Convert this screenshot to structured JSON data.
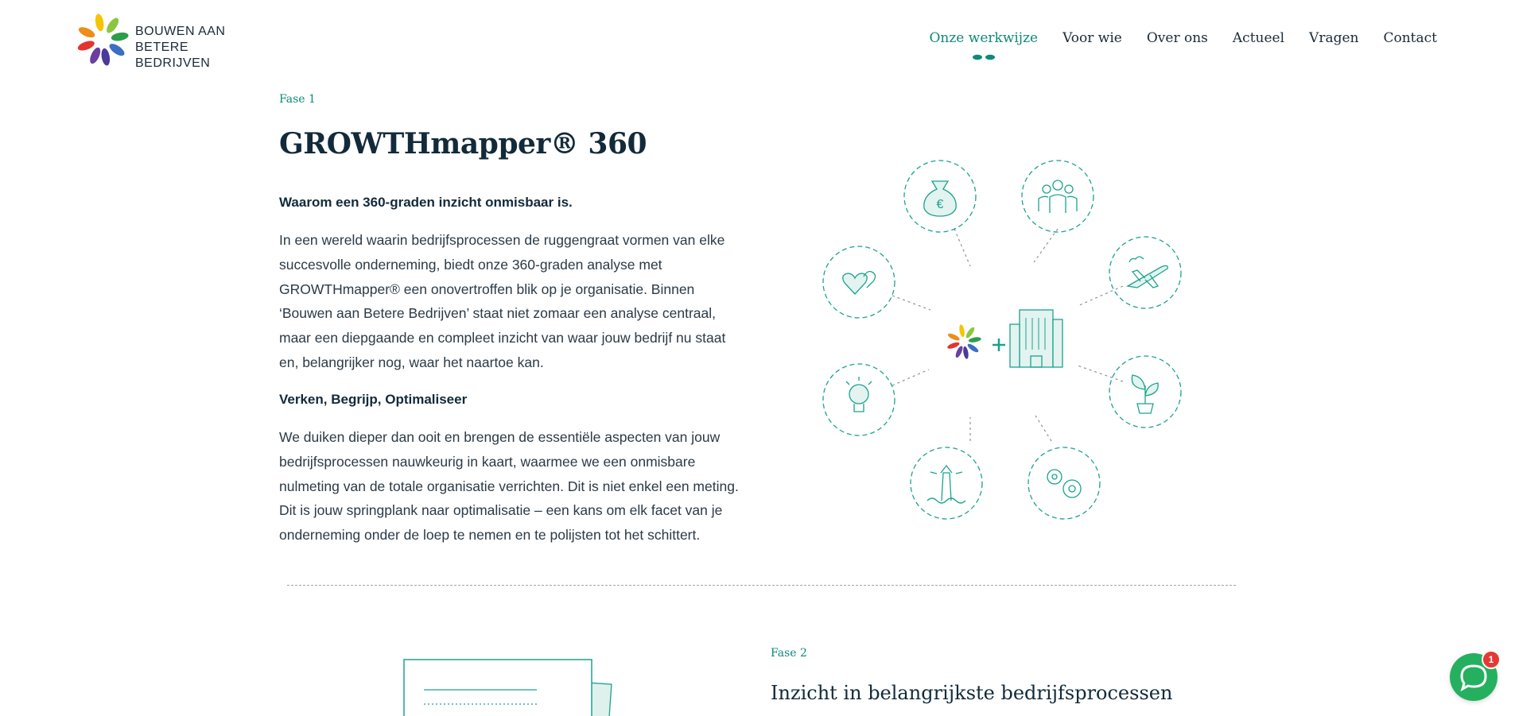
{
  "brand": {
    "line1": "BOUWEN AAN",
    "line2": "BETERE BEDRIJVEN",
    "logo_icon": "flower-logo-icon",
    "petal_colors": [
      "#f6c400",
      "#8cc63f",
      "#2e9d4b",
      "#3a6fc4",
      "#4a3a9a",
      "#6a3fa0",
      "#e3342f",
      "#f08c1a"
    ]
  },
  "nav": {
    "items": [
      "Onze werkwijze",
      "Voor wie",
      "Over ons",
      "Actueel",
      "Vragen",
      "Contact"
    ],
    "active_index": 0
  },
  "phase1": {
    "label": "Fase 1",
    "title": "GROWTHmapper® 360",
    "subhead1": "Waarom een 360-graden inzicht onmisbaar is.",
    "para1": "In een wereld waarin bedrijfsprocessen de ruggengraat vormen van elke succesvolle onderneming, biedt onze 360-graden analyse met GROWTHmapper® een onovertroffen blik op je organisatie. Binnen ‘Bouwen aan Betere Bedrijven’ staat niet zomaar een analyse centraal, maar een diepgaande en compleet inzicht van waar jouw bedrijf nu staat en, belangrijker nog, waar het naartoe kan.",
    "subhead2": "Verken, Begrijp, Optimaliseer",
    "para2": "We duiken dieper dan ooit en brengen de essentiële aspecten van jouw bedrijfsprocessen nauwkeurig in kaart, waarmee we een onmisbare nulmeting van de totale organisatie verrichten. Dit is niet enkel een meting. Dit is jouw springplank naar optimalisatie – een kans om elk facet van je onderneming onder de loep te nemen en te polijsten tot het schittert."
  },
  "illustration": {
    "icons": [
      "money-bag-icon",
      "team-icon",
      "airplane-icon",
      "plant-icon",
      "gears-icon",
      "lighthouse-icon",
      "lightbulb-icon",
      "hearts-icon"
    ],
    "center": [
      "flower-logo-icon",
      "plus-icon",
      "building-icon"
    ],
    "accent": "#1aa38f"
  },
  "phase2": {
    "label": "Fase 2",
    "title": "Inzicht in belangrijkste bedrijfsprocessen"
  },
  "chat": {
    "icon": "chat-bubble-icon",
    "badge": "1"
  },
  "colors": {
    "teal": "#0e8a7a",
    "navy": "#122a3a",
    "chat_green": "#25b060",
    "badge_red": "#e53935"
  }
}
